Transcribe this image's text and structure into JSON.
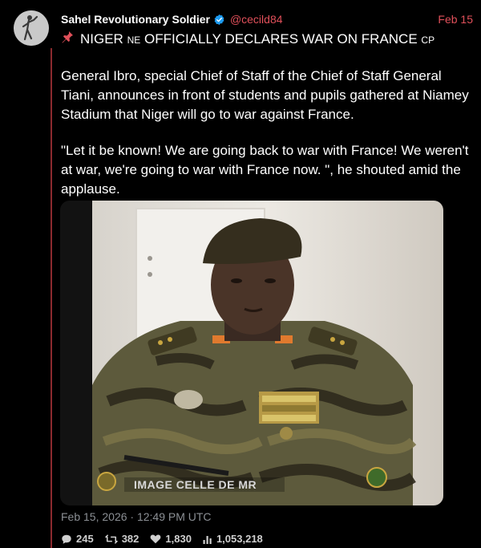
{
  "author": {
    "display_name": "Sahel Revolutionary Soldier",
    "handle": "@cecild84",
    "date": "Feb 15",
    "verified_icon": "verified-badge-icon",
    "accent_color": "#e0505a"
  },
  "post": {
    "pin_icon": "pushpin-icon",
    "headline_main": "NIGER",
    "headline_ne": "NE",
    "headline_rest": "OFFICIALLY DECLARES WAR ON FRANCE",
    "headline_cp": "CP",
    "paragraph_1": "General Ibro, special Chief of Staff of the Chief of Staff General Tiani, announces in front of students and pupils gathered at Niamey Stadium that Niger will go to war against France.",
    "paragraph_2": "\"Let it be known! We are going back to war with France! We weren't at war, we're going to war with France now. \", he shouted amid the applause.",
    "image_caption": "IMAGE CELLE DE MR",
    "timestamp": "Feb 15, 2026 · 12:49 PM UTC"
  },
  "stats": {
    "replies": "245",
    "reposts": "382",
    "likes": "1,830",
    "views": "1,053,218"
  }
}
